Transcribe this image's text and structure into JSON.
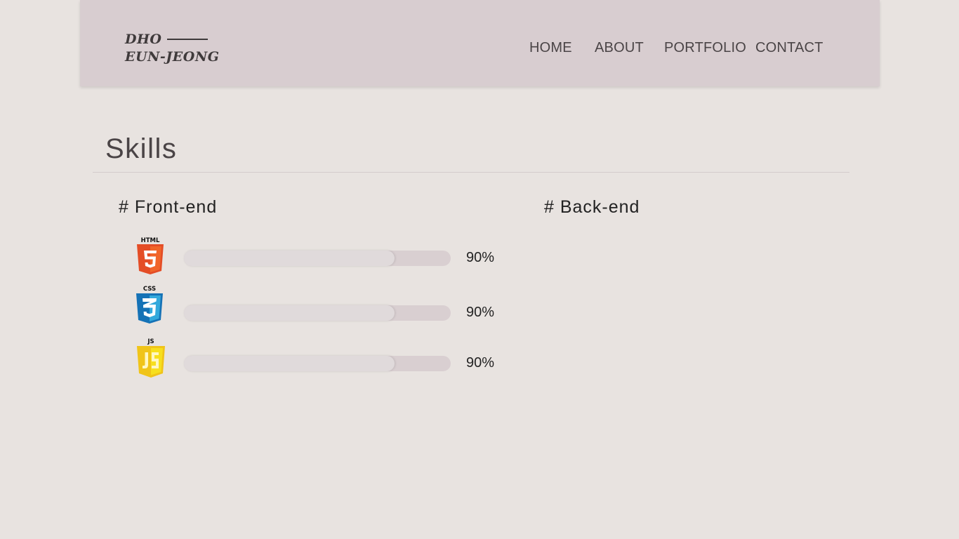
{
  "header": {
    "logo_line1": "DHO",
    "logo_line2": "EUN-JEONG",
    "nav": {
      "home": "HOME",
      "about": "ABOUT",
      "portfolio": "PORTFOLIO",
      "contact": "CONTACT"
    }
  },
  "skills": {
    "title": "Skills",
    "frontend_heading": "# Front-end",
    "backend_heading": "# Back-end",
    "frontend": [
      {
        "name": "HTML",
        "icon": "html5-icon",
        "percent_label": "90%",
        "fill_fraction": 0.79,
        "color": "#e44d26"
      },
      {
        "name": "CSS",
        "icon": "css3-icon",
        "percent_label": "90%",
        "fill_fraction": 0.79,
        "color": "#1572b6"
      },
      {
        "name": "JS",
        "icon": "js-icon",
        "percent_label": "90%",
        "fill_fraction": 0.79,
        "color": "#f0db4f"
      }
    ]
  }
}
